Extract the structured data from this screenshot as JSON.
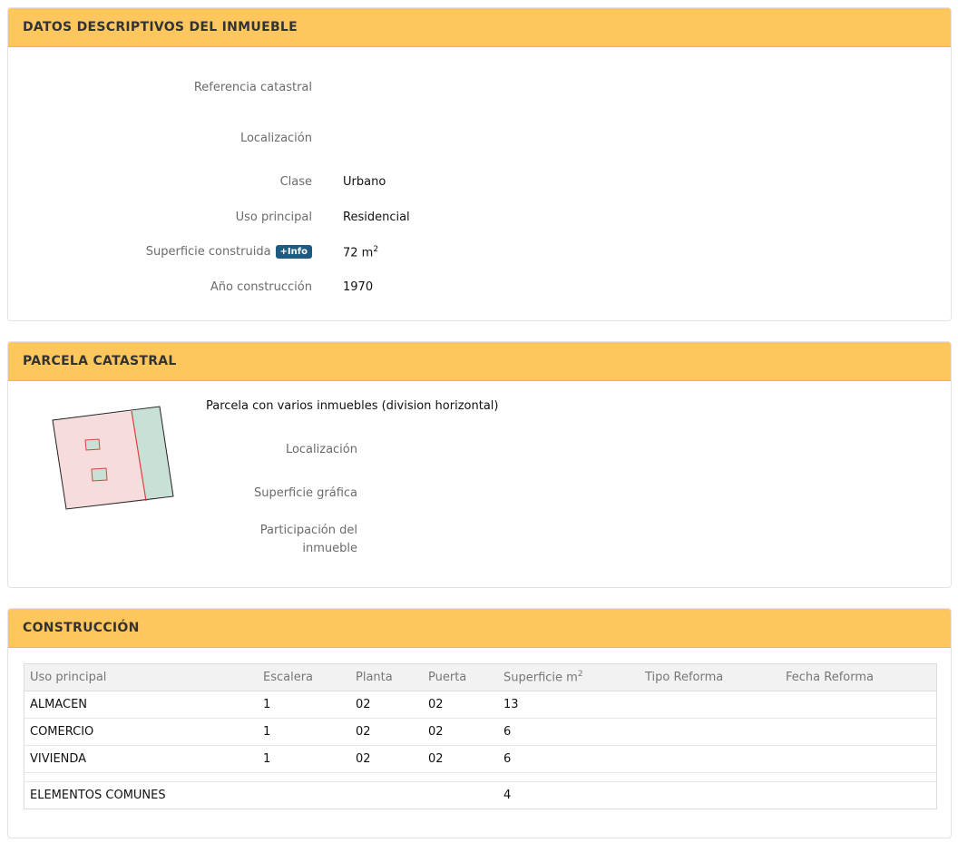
{
  "datos": {
    "title": "DATOS DESCRIPTIVOS DEL INMUEBLE",
    "fields": [
      {
        "label": "Referencia catastral",
        "value": ""
      },
      {
        "label": "Localización",
        "value": ""
      },
      {
        "label": "Clase",
        "value": "Urbano"
      },
      {
        "label": "Uso principal",
        "value": "Residencial"
      },
      {
        "label": "Superficie construida",
        "value": "72 m",
        "badge": "+Info",
        "sup": "2"
      },
      {
        "label": "Año construcción",
        "value": "1970"
      }
    ]
  },
  "parcela": {
    "title": "PARCELA CATASTRAL",
    "description": "Parcela con varios inmuebles (division horizontal)",
    "fields": [
      {
        "label": "Localización",
        "value": ""
      },
      {
        "label": "Superficie gráfica",
        "value": ""
      },
      {
        "label": "Participación del inmueble",
        "value": ""
      }
    ],
    "colors": {
      "main_plot": "#f6dcdc",
      "side_plot": "#c9e0d6",
      "boundary": "#e04040",
      "outline": "#222222"
    }
  },
  "construccion": {
    "title": "CONSTRUCCIÓN",
    "columns": [
      "Uso principal",
      "Escalera",
      "Planta",
      "Puerta",
      "Superficie m",
      "Tipo Reforma",
      "Fecha Reforma"
    ],
    "superficie_sup": "2",
    "rows": [
      [
        "ALMACEN",
        "1",
        "02",
        "02",
        "13",
        "",
        ""
      ],
      [
        "COMERCIO",
        "1",
        "02",
        "02",
        "6",
        "",
        ""
      ],
      [
        "VIVIENDA",
        "1",
        "02",
        "02",
        "6",
        "",
        ""
      ]
    ],
    "common": {
      "label": "ELEMENTOS COMUNES",
      "superficie": "4"
    }
  }
}
